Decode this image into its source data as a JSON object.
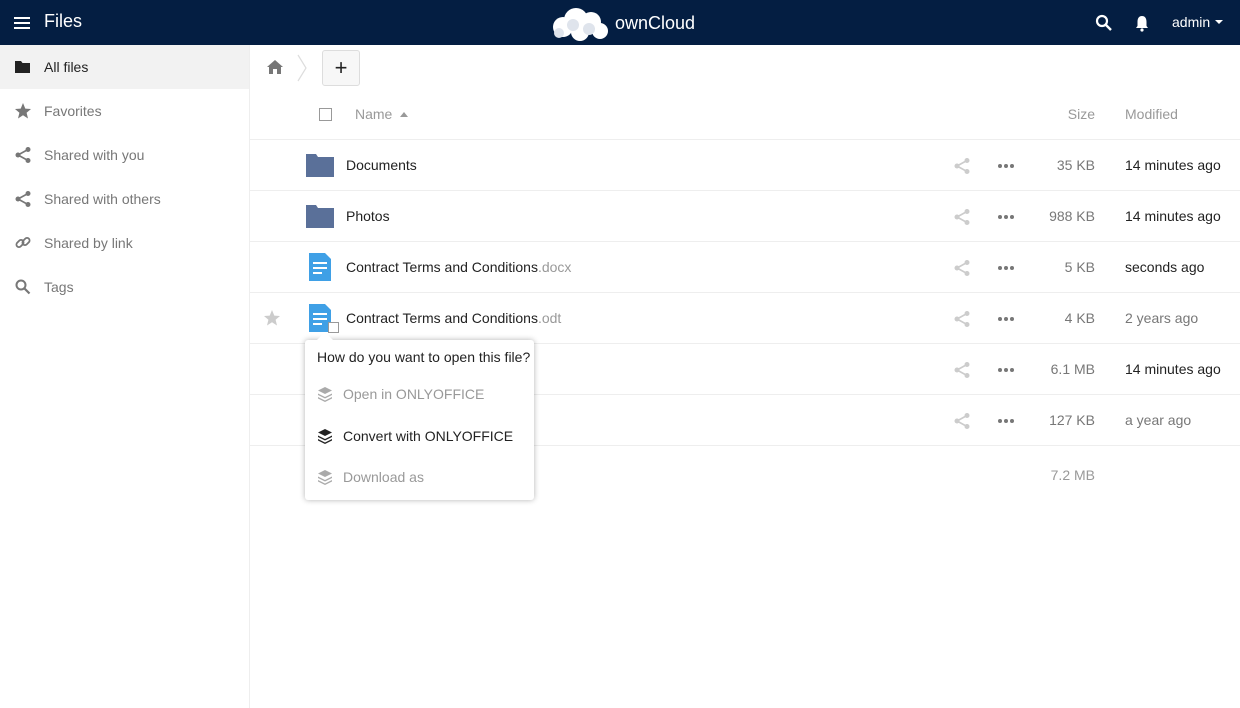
{
  "header": {
    "app_name": "Files",
    "brand": "ownCloud",
    "user": "admin"
  },
  "sidebar": {
    "items": [
      {
        "label": "All files",
        "icon": "folder-icon",
        "active": true
      },
      {
        "label": "Favorites",
        "icon": "star-icon"
      },
      {
        "label": "Shared with you",
        "icon": "share-icon"
      },
      {
        "label": "Shared with others",
        "icon": "share-icon"
      },
      {
        "label": "Shared by link",
        "icon": "link-icon"
      },
      {
        "label": "Tags",
        "icon": "search-icon"
      }
    ]
  },
  "controls": {
    "new_label": "+"
  },
  "table": {
    "headers": {
      "name": "Name",
      "size": "Size",
      "modified": "Modified"
    },
    "rows": [
      {
        "name": "Documents",
        "ext": "",
        "type": "folder",
        "size": "35 KB",
        "modified": "14 minutes ago"
      },
      {
        "name": "Photos",
        "ext": "",
        "type": "folder",
        "size": "988 KB",
        "modified": "14 minutes ago"
      },
      {
        "name": "Contract Terms and Conditions",
        "ext": ".docx",
        "type": "document",
        "size": "5 KB",
        "modified": "seconds ago"
      },
      {
        "name": "Contract Terms and Conditions",
        "ext": ".odt",
        "type": "document",
        "size": "4 KB",
        "modified": "2 years ago"
      },
      {
        "name": "",
        "ext": "",
        "type": "hidden",
        "size": "6.1 MB",
        "modified": "14 minutes ago"
      },
      {
        "name": "",
        "ext": "",
        "type": "hidden",
        "size": "127 KB",
        "modified": "a year ago"
      }
    ],
    "total_size": "7.2 MB"
  },
  "popover": {
    "title": "How do you want to open this file?",
    "items": [
      {
        "label": "Open in ONLYOFFICE",
        "enabled": false
      },
      {
        "label": "Convert with ONLYOFFICE",
        "enabled": true
      },
      {
        "label": "Download as",
        "enabled": false
      }
    ]
  },
  "colors": {
    "header_bg": "#041e42",
    "folder": "#5a7099",
    "document": "#3fa0e6"
  }
}
